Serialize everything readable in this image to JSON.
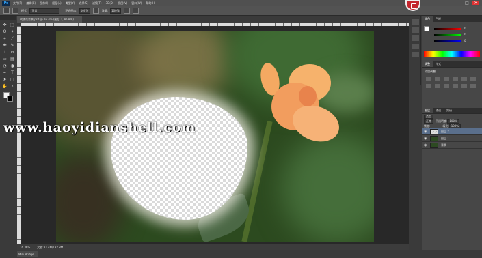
{
  "app": {
    "logo": "Ps"
  },
  "menubar": {
    "items": [
      "文件(F)",
      "编辑(E)",
      "图像(I)",
      "图层(L)",
      "类型(Y)",
      "选择(S)",
      "滤镜(T)",
      "3D(D)",
      "视图(V)",
      "窗口(W)",
      "帮助(H)"
    ],
    "controls": {
      "minimize": "–",
      "restore": "□",
      "close": "✕"
    }
  },
  "options_bar": {
    "mode_label": "模式:",
    "mode_value": "正常",
    "opacity_label": "不透明度:",
    "opacity_value": "100%",
    "flow_label": "流量:",
    "flow_value": "100%"
  },
  "document": {
    "tab_title": "玫瑰花背景.psd @ 16.4% (图层 1, RGB/8)",
    "status_zoom": "16.36%",
    "status_doc": "文档:33.4M/132.8M",
    "bottom_tab": "Mini Bridge"
  },
  "panels": {
    "color_tabs": [
      "颜色",
      "色板"
    ],
    "color_values": [
      "0",
      "0",
      "0"
    ],
    "adjust_tabs": [
      "调整",
      "样式"
    ],
    "adjust_title": "添加调整",
    "layers_tabs": [
      "图层",
      "通道",
      "路径"
    ],
    "kind_label": "类型",
    "blend_mode": "正常",
    "opacity_label": "不透明度:",
    "opacity_value": "100%",
    "lock_label": "锁定:",
    "fill_label": "填充:",
    "fill_value": "100%",
    "layers": [
      {
        "name": "图层 2"
      },
      {
        "name": "图层 1"
      },
      {
        "name": "背景"
      }
    ]
  },
  "watermark": "www.haoyidianshell.com"
}
